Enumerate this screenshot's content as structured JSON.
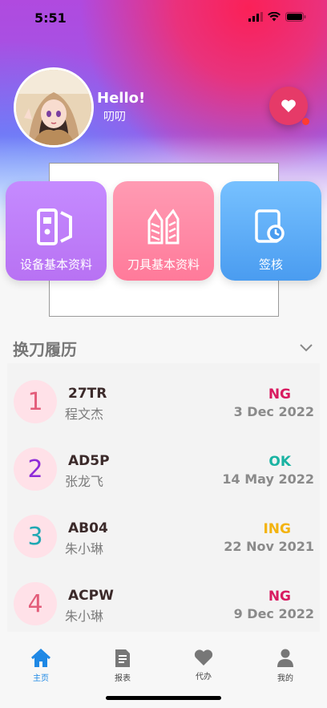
{
  "status_bar": {
    "time": "5:51"
  },
  "profile": {
    "greeting": "Hello!",
    "nickname": "叨叨"
  },
  "quick_actions": [
    {
      "label": "设备基本资料",
      "icon": "device-panel-icon"
    },
    {
      "label": "刀具基本资料",
      "icon": "tools-icon"
    },
    {
      "label": "签核",
      "icon": "sign-off-icon"
    }
  ],
  "history": {
    "title": "换刀履历",
    "items": [
      {
        "index": "1",
        "code": "27TR",
        "person": "程文杰",
        "status": "NG",
        "date": "3 Dec 2022",
        "status_color": "#d81b60",
        "index_color": "#e35d7a"
      },
      {
        "index": "2",
        "code": "AD5P",
        "person": "张龙飞",
        "status": "OK",
        "date": "14 May 2022",
        "status_color": "#19b3a2",
        "index_color": "#8e2bd8"
      },
      {
        "index": "3",
        "code": "AB04",
        "person": "朱小琳",
        "status": "ING",
        "date": "22 Nov 2021",
        "status_color": "#f3b30e",
        "index_color": "#20a8b3"
      },
      {
        "index": "4",
        "code": "ACPW",
        "person": "朱小琳",
        "status": "NG",
        "date": "9 Dec 2022",
        "status_color": "#d81b60",
        "index_color": "#e35d7a"
      }
    ]
  },
  "tabbar": {
    "tabs": [
      {
        "label": "主页",
        "icon": "home-icon",
        "active": true
      },
      {
        "label": "报表",
        "icon": "report-icon",
        "active": false
      },
      {
        "label": "代办",
        "icon": "heart-icon",
        "active": false
      },
      {
        "label": "我的",
        "icon": "person-icon",
        "active": false
      }
    ]
  },
  "colors": {
    "accent": "#1e88e5",
    "fav_button": "#e63a68"
  }
}
